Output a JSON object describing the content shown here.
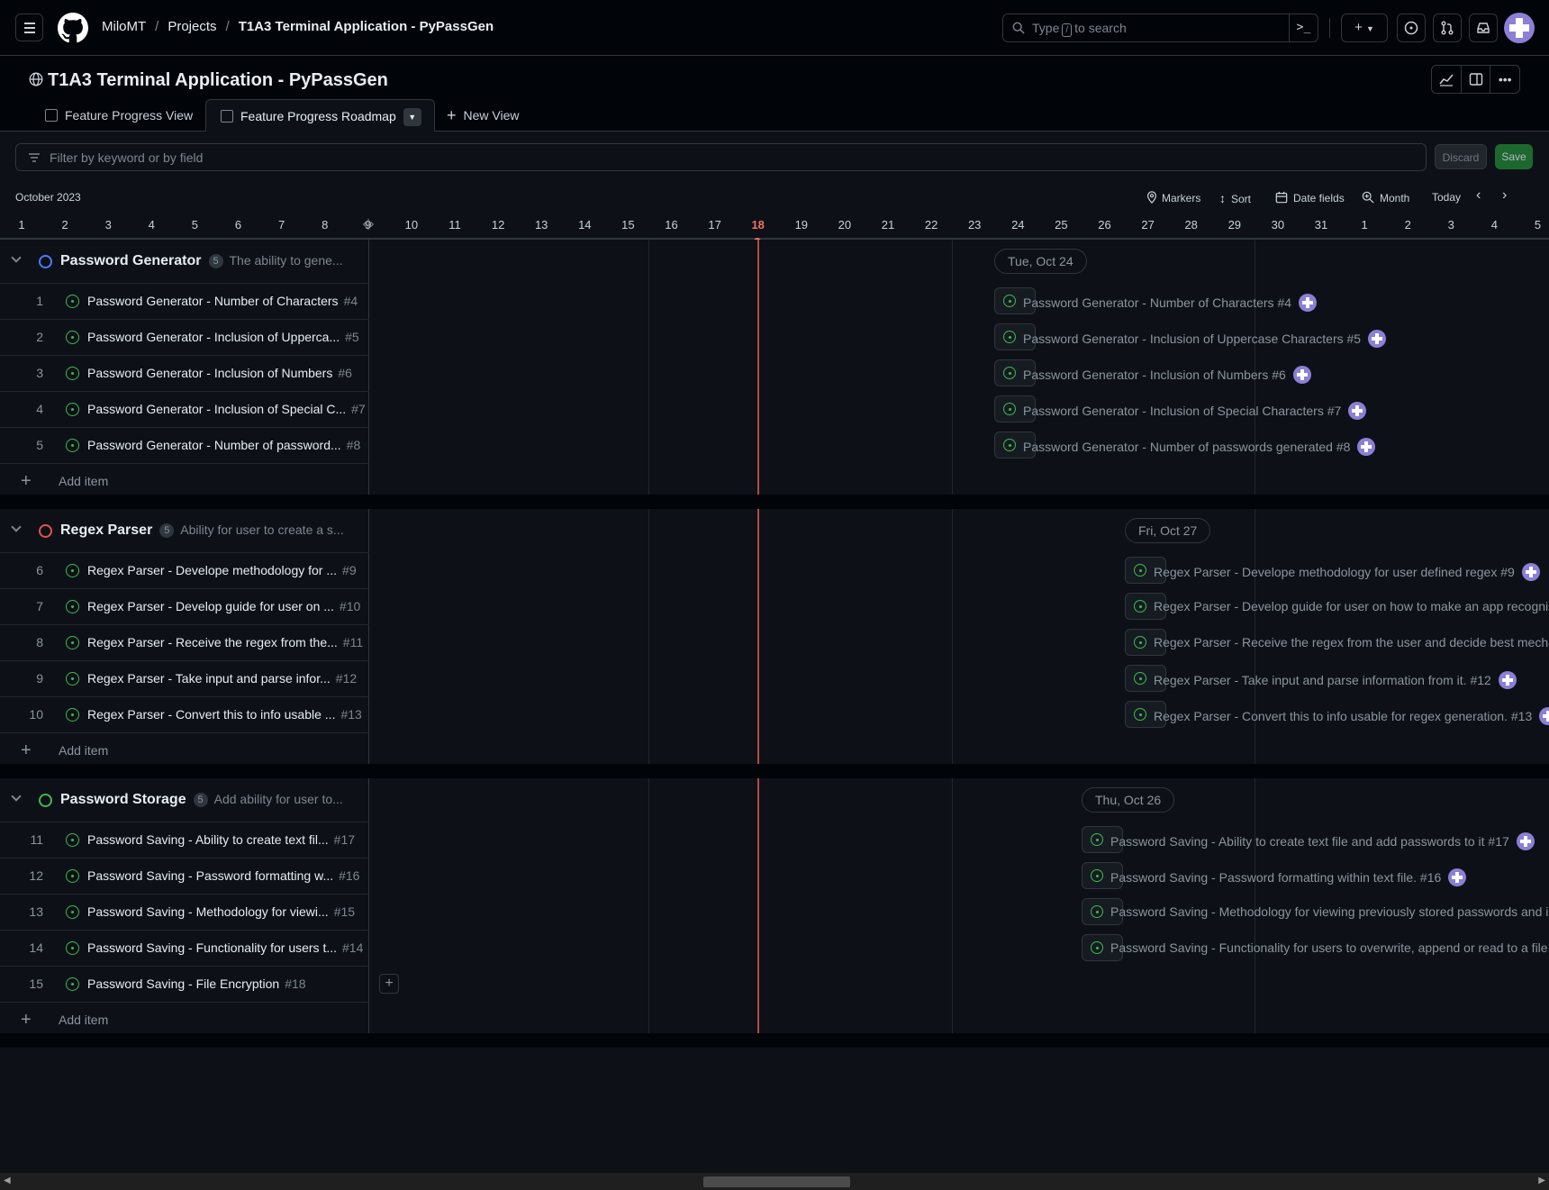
{
  "header": {
    "breadcrumb": [
      "MiloMT",
      "Projects",
      "T1A3 Terminal Application - PyPassGen"
    ],
    "search_before": "Type",
    "search_key": "/",
    "search_after": "to search",
    "command_glyph": ">_"
  },
  "project": {
    "title": "T1A3 Terminal Application - PyPassGen",
    "tabs": [
      {
        "label": "Feature Progress View"
      },
      {
        "label": "Feature Progress Roadmap"
      },
      {
        "label": "New View"
      }
    ]
  },
  "filter": {
    "placeholder": "Filter by keyword or by field",
    "discard": "Discard",
    "save": "Save"
  },
  "roadmap": {
    "month_label": "October 2023",
    "tools": {
      "markers": "Markers",
      "sort": "Sort",
      "date_fields": "Date fields",
      "zoom": "Month",
      "today": "Today"
    },
    "days": [
      "1",
      "2",
      "3",
      "4",
      "5",
      "6",
      "7",
      "8",
      "9",
      "10",
      "11",
      "12",
      "13",
      "14",
      "15",
      "16",
      "17",
      "18",
      "19",
      "20",
      "21",
      "22",
      "23",
      "24",
      "25",
      "26",
      "27",
      "28",
      "29",
      "30",
      "31",
      "1",
      "2",
      "3",
      "4",
      "5"
    ],
    "today_day": "18"
  },
  "groups": [
    {
      "title": "Password Generator",
      "count": "5",
      "description": "The ability to gene...",
      "status_color": "#4c7bf3",
      "date_pill": "Tue, Oct 24",
      "items": [
        {
          "num": "1",
          "title": "Password Generator - Number of Characters",
          "issue": "#4",
          "bar_title": "Password Generator - Number of Characters #4"
        },
        {
          "num": "2",
          "title": "Password Generator - Inclusion of Upperca...",
          "issue": "#5",
          "bar_title": "Password Generator - Inclusion of Uppercase Characters #5"
        },
        {
          "num": "3",
          "title": "Password Generator - Inclusion of Numbers",
          "issue": "#6",
          "bar_title": "Password Generator - Inclusion of Numbers #6"
        },
        {
          "num": "4",
          "title": "Password Generator - Inclusion of Special C...",
          "issue": "#7",
          "bar_title": "Password Generator - Inclusion of Special Characters #7"
        },
        {
          "num": "5",
          "title": "Password Generator - Number of password...",
          "issue": "#8",
          "bar_title": "Password Generator - Number of passwords generated #8"
        }
      ],
      "add_item": "Add item"
    },
    {
      "title": "Regex Parser",
      "count": "5",
      "description": "Ability for user to create a s...",
      "status_color": "#e5534b",
      "date_pill": "Fri, Oct 27",
      "items": [
        {
          "num": "6",
          "title": "Regex Parser - Develope methodology for ...",
          "issue": "#9",
          "bar_title": "Regex Parser - Develope methodology for user defined regex #9"
        },
        {
          "num": "7",
          "title": "Regex Parser - Develop guide for user on ...",
          "issue": "#10",
          "bar_title": "Regex Parser - Develop guide for user on how to make an app recognis"
        },
        {
          "num": "8",
          "title": "Regex Parser - Receive the regex from the...",
          "issue": "#11",
          "bar_title": "Regex Parser - Receive the regex from the user and decide best mechar"
        },
        {
          "num": "9",
          "title": "Regex Parser - Take input and parse infor...",
          "issue": "#12",
          "bar_title": "Regex Parser - Take input and parse information from it. #12"
        },
        {
          "num": "10",
          "title": "Regex Parser - Convert this to info usable ...",
          "issue": "#13",
          "bar_title": "Regex Parser - Convert this to info usable for regex generation. #13"
        }
      ],
      "add_item": "Add item"
    },
    {
      "title": "Password Storage",
      "count": "5",
      "description": "Add ability for user to...",
      "status_color": "#3fb950",
      "date_pill": "Thu, Oct 26",
      "items": [
        {
          "num": "11",
          "title": "Password Saving - Ability to create text fil...",
          "issue": "#17",
          "bar_title": "Password Saving - Ability to create text file and add passwords to it #17"
        },
        {
          "num": "12",
          "title": "Password Saving - Password formatting w...",
          "issue": "#16",
          "bar_title": "Password Saving - Password formatting within text file. #16"
        },
        {
          "num": "13",
          "title": "Password Saving - Methodology for viewi...",
          "issue": "#15",
          "bar_title": "Password Saving - Methodology for viewing previously stored passwords and i"
        },
        {
          "num": "14",
          "title": "Password Saving - Functionality for users t...",
          "issue": "#14",
          "bar_title": "Password Saving - Functionality for users to overwrite, append or read to a file."
        },
        {
          "num": "15",
          "title": "Password Saving - File Encryption",
          "issue": "#18",
          "bar_title": ""
        }
      ],
      "add_item": "Add item"
    }
  ]
}
